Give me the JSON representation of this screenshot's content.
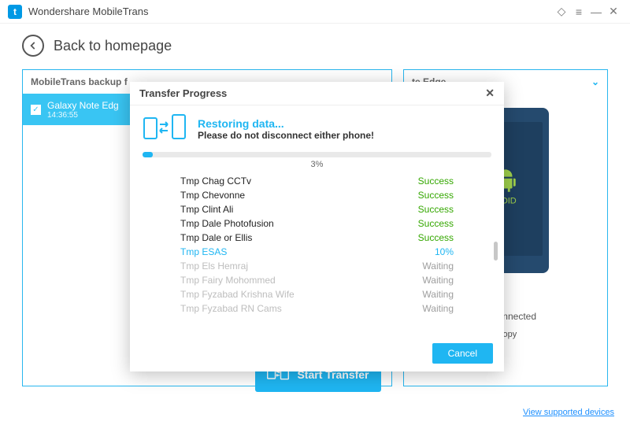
{
  "titlebar": {
    "app_name": "Wondershare MobileTrans"
  },
  "back": {
    "label": "Back to homepage"
  },
  "left_panel": {
    "header": "MobileTrans backup f"
  },
  "backup_item": {
    "name": "Galaxy Note Edg",
    "time": "14:36:55"
  },
  "right_panel": {
    "header": "te Edge",
    "android_label": "ROID"
  },
  "connected": {
    "label": "Connected"
  },
  "clear": {
    "label": "Clear data before copy"
  },
  "start": {
    "label": "Start Transfer"
  },
  "footer_link": {
    "label": "View supported devices"
  },
  "modal": {
    "title": "Transfer Progress",
    "heading": "Restoring data...",
    "sub": "Please do not disconnect either phone!",
    "pct_text": "3%",
    "pct_fill": "3%",
    "cancel": "Cancel",
    "items": [
      {
        "name": "Tmp Chag CCTv",
        "status": "Success",
        "cls": "done"
      },
      {
        "name": "Tmp Chevonne",
        "status": "Success",
        "cls": "done"
      },
      {
        "name": "Tmp Clint Ali",
        "status": "Success",
        "cls": "done"
      },
      {
        "name": "Tmp Dale Photofusion",
        "status": "Success",
        "cls": "done"
      },
      {
        "name": "Tmp Dale or Ellis",
        "status": "Success",
        "cls": "done"
      },
      {
        "name": "Tmp ESAS",
        "status": "10%",
        "cls": "cur"
      },
      {
        "name": "Tmp Els Hemraj",
        "status": "Waiting",
        "cls": "wait"
      },
      {
        "name": "Tmp Fairy Mohommed",
        "status": "Waiting",
        "cls": "wait"
      },
      {
        "name": "Tmp Fyzabad Krishna Wife",
        "status": "Waiting",
        "cls": "wait"
      },
      {
        "name": "Tmp Fyzabad RN Cams",
        "status": "Waiting",
        "cls": "wait"
      }
    ]
  }
}
